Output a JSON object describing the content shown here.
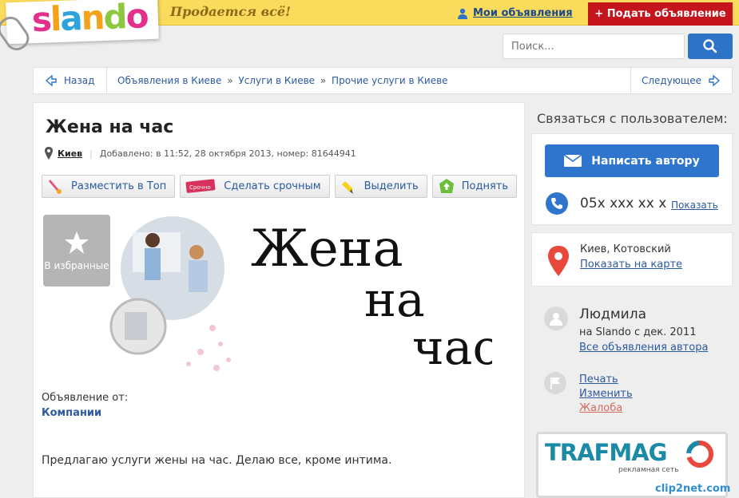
{
  "header": {
    "logo_text": "slando",
    "slogan": "Продается всё!",
    "my_ads": "Мои объявления",
    "post_ad": "+ Подать объявление"
  },
  "search": {
    "placeholder": "Поиск..."
  },
  "crumbbar": {
    "back": "Назад",
    "crumbs": [
      "Объявления в Киеве",
      "Услуги в Киеве",
      "Прочие услуги в Киеве"
    ],
    "separator": "»",
    "next": "Следующее"
  },
  "ad": {
    "title": "Жена на час",
    "city": "Киев",
    "meta": "Добавлено: в 11:52, 28 октября 2013, номер: 81644941",
    "actions": [
      "Разместить в Топ",
      "Сделать срочным",
      "Выделить",
      "Поднять"
    ],
    "urgent_tag": "Срочно",
    "favorite": "В избранные",
    "image_text": [
      "Жена",
      "на",
      "час"
    ],
    "from_label": "Объявление от:",
    "from_value": "Компании",
    "description": "Предлагаю услуги жены на час. Делаю все, кроме интима."
  },
  "contact": {
    "heading": "Связаться с пользователем:",
    "write_button": "Написать автору",
    "phone": "05x xxx xx x",
    "show_phone": "Показать",
    "location": "Киев, Котовский",
    "show_map": "Показать на карте"
  },
  "user": {
    "name": "Людмила",
    "since": "на Slando с дек. 2011",
    "all_ads": "Все объявления автора"
  },
  "links": {
    "print": "Печать",
    "edit": "Изменить",
    "complain": "Жалоба"
  },
  "banner": {
    "title": "TRAFMAG",
    "subtitle": "рекламная сеть",
    "footer": "clip2net.com"
  },
  "colors": {
    "topbar": "#fbdb5c",
    "accent_red": "#c4141c",
    "accent_blue": "#2f74cd",
    "link": "#2c5aa0"
  }
}
